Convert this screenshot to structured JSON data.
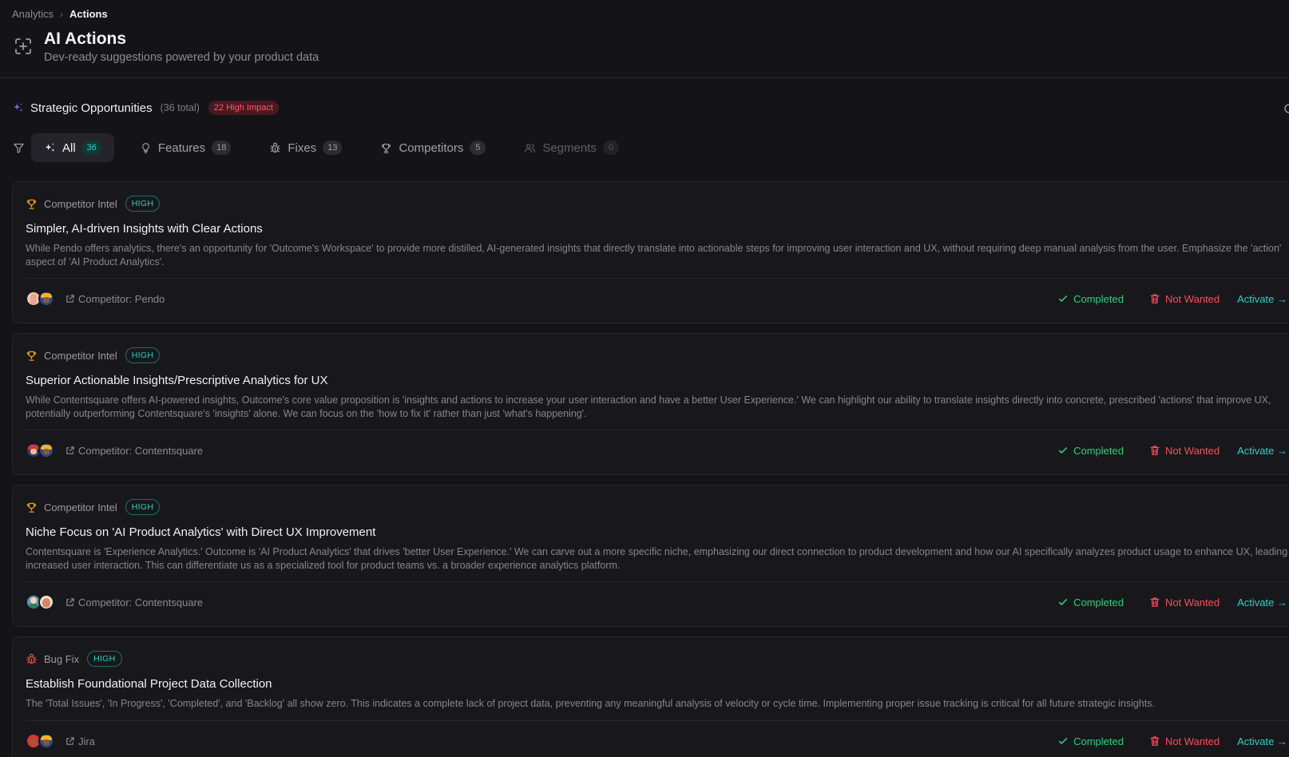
{
  "breadcrumb": {
    "parent": "Analytics",
    "separator": "›",
    "current": "Actions"
  },
  "header": {
    "title": "AI Actions",
    "subtitle": "Dev-ready suggestions powered by your product data"
  },
  "section": {
    "title": "Strategic Opportunities",
    "total": "(36 total)",
    "impact_badge": "22 High Impact"
  },
  "tabs": [
    {
      "label": "All",
      "count": "36",
      "icon": "sparkles-icon",
      "state": "active"
    },
    {
      "label": "Features",
      "count": "18",
      "icon": "lightbulb-icon",
      "state": "normal"
    },
    {
      "label": "Fixes",
      "count": "13",
      "icon": "bug-icon",
      "state": "normal"
    },
    {
      "label": "Competitors",
      "count": "5",
      "icon": "trophy-icon",
      "state": "normal"
    },
    {
      "label": "Segments",
      "count": "0",
      "icon": "users-icon",
      "state": "disabled"
    }
  ],
  "actions_labels": {
    "completed": "Completed",
    "not_wanted": "Not Wanted",
    "activate": "Activate →"
  },
  "cards": [
    {
      "category": "Competitor Intel",
      "category_icon": "trophy-icon",
      "priority": "HIGH",
      "title": "Simpler, AI-driven Insights with Clear Actions",
      "description": "While Pendo offers analytics, there's an opportunity for 'Outcome's Workspace' to provide more distilled, AI-generated insights that directly translate into actionable steps for improving user interaction and UX, without requiring deep manual analysis from the user. Emphasize the 'action' aspect of 'AI Product Analytics'.",
      "source": "Competitor: Pendo"
    },
    {
      "category": "Competitor Intel",
      "category_icon": "trophy-icon",
      "priority": "HIGH",
      "title": "Superior Actionable Insights/Prescriptive Analytics for UX",
      "description": "While Contentsquare offers AI-powered insights, Outcome's core value proposition is 'insights and actions to increase your user interaction and have a better User Experience.' We can highlight our ability to translate insights directly into concrete, prescribed 'actions' that improve UX, potentially outperforming Contentsquare's 'insights' alone. We can focus on the 'how to fix it' rather than just 'what's happening'.",
      "source": "Competitor: Contentsquare"
    },
    {
      "category": "Competitor Intel",
      "category_icon": "trophy-icon",
      "priority": "HIGH",
      "title": "Niche Focus on 'AI Product Analytics' with Direct UX Improvement",
      "description": "Contentsquare is 'Experience Analytics.' Outcome is 'AI Product Analytics' that drives 'better User Experience.' We can carve out a more specific niche, emphasizing our direct connection to product development and how our AI specifically analyzes product usage to enhance UX, leading to increased user interaction. This can differentiate us as a specialized tool for product teams vs. a broader experience analytics platform.",
      "source": "Competitor: Contentsquare"
    },
    {
      "category": "Bug Fix",
      "category_icon": "bug-icon",
      "priority": "HIGH",
      "title": "Establish Foundational Project Data Collection",
      "description": "The 'Total Issues', 'In Progress', 'Completed', and 'Backlog' all show zero. This indicates a complete lack of project data, preventing any meaningful analysis of velocity or cycle time. Implementing proper issue tracking is critical for all future strategic insights.",
      "source": "Jira"
    }
  ],
  "colors": {
    "accent_teal": "#2fd0c0",
    "complete_green": "#2fcf7a",
    "danger_red": "#ff4a5a",
    "trophy_orange": "#f59e0b",
    "bug_red": "#ef4444",
    "sparkle_purple": "#8b5cf6"
  }
}
